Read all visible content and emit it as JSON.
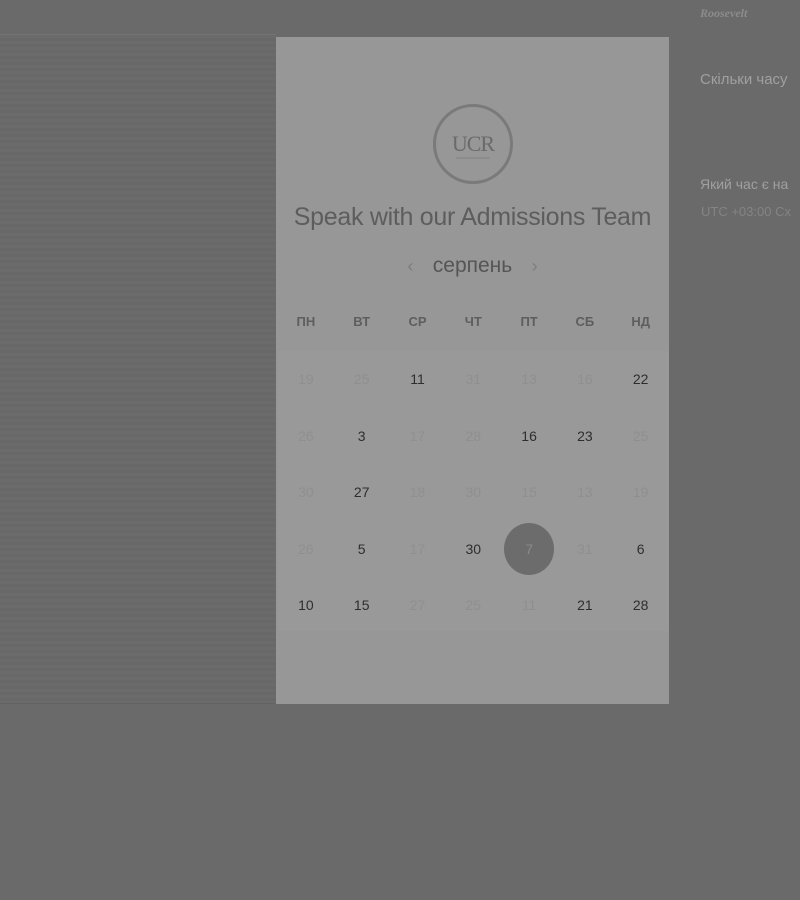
{
  "header": {
    "logo_subtitle": "",
    "logo_script": "Roosevelt"
  },
  "side": {
    "question_1": "Скільки часу",
    "question_2": "Який час є на",
    "timezone_note": "UTC +03:00 Сх"
  },
  "modal": {
    "logo_text": "UCR",
    "title": "Speak with our Admissions Team",
    "month_label": "серпень",
    "prev_icon": "‹",
    "next_icon": "›",
    "weekdays": [
      "ПН",
      "ВТ",
      "СР",
      "ЧТ",
      "ПТ",
      "СБ",
      "НД"
    ],
    "weeks": [
      [
        "19",
        "25",
        "11",
        "31",
        "13",
        "16",
        "22"
      ],
      [
        "26",
        "3",
        "17",
        "28",
        "16",
        "23",
        "25"
      ],
      [
        "30",
        "27",
        "18",
        "30",
        "15",
        "13",
        "19"
      ],
      [
        "26",
        "5",
        "17",
        "30",
        "7",
        "31",
        "6"
      ],
      [
        "10",
        "15",
        "27",
        "25",
        "11",
        "21",
        "28"
      ]
    ],
    "available": [
      [
        false,
        false,
        true,
        false,
        false,
        false,
        true
      ],
      [
        false,
        true,
        false,
        false,
        true,
        true,
        false
      ],
      [
        false,
        true,
        false,
        false,
        false,
        false,
        false
      ],
      [
        false,
        true,
        false,
        true,
        true,
        false,
        true
      ],
      [
        true,
        true,
        false,
        false,
        false,
        true,
        true
      ]
    ],
    "selected_day": "7"
  }
}
